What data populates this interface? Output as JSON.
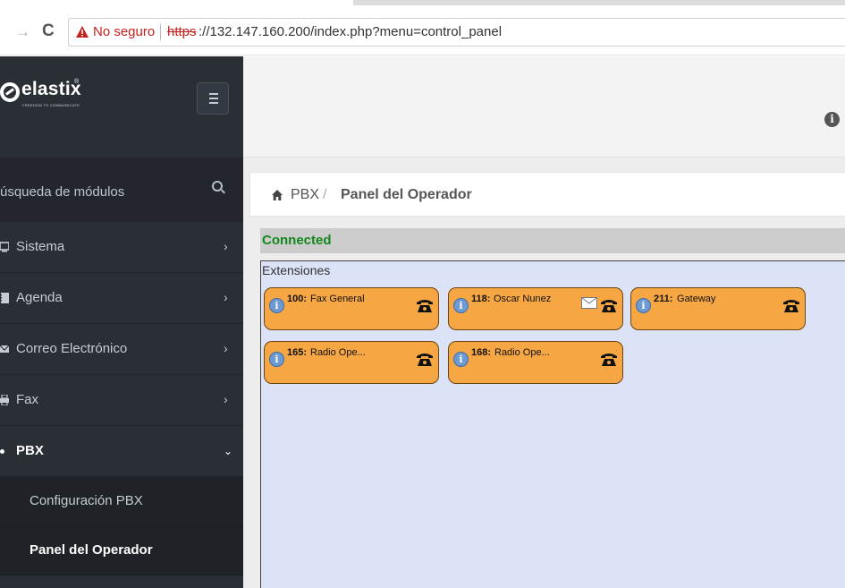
{
  "browser": {
    "insecure_label": "No seguro",
    "url_scheme": "https",
    "url_rest": "://132.147.160.200/index.php?menu=control_panel"
  },
  "sidebar": {
    "logo_text": "elastix",
    "logo_registered": "®",
    "logo_tagline": "FREEDOM TO COMMUNICATE",
    "search_placeholder": "úsqueda de módulos",
    "items": [
      {
        "label": "Sistema",
        "icon": "monitor-icon"
      },
      {
        "label": "Agenda",
        "icon": "address-book-icon"
      },
      {
        "label": "Correo Electrónico",
        "icon": "envelope-icon"
      },
      {
        "label": "Fax",
        "icon": "printer-icon"
      },
      {
        "label": "PBX",
        "icon": "bullet-icon"
      }
    ],
    "subitems": [
      {
        "label": "Configuración PBX"
      },
      {
        "label": "Panel del Operador"
      }
    ]
  },
  "header": {
    "info_icon": "info-icon",
    "info_glyph": "i"
  },
  "breadcrumb": {
    "section": "PBX",
    "separator": "/",
    "current": "Panel del Operador"
  },
  "status": {
    "text": "Connected",
    "color": "#13881a"
  },
  "panel": {
    "title": "Extensiones",
    "color": "#dde3f6",
    "card_color": "#f6a642",
    "extensions": [
      {
        "number": "100:",
        "name": "Fax General",
        "voicemail": false
      },
      {
        "number": "118:",
        "name": "Oscar Nunez",
        "voicemail": true
      },
      {
        "number": "211:",
        "name": "Gateway",
        "voicemail": false
      },
      {
        "number": "165:",
        "name": "Radio Ope...",
        "voicemail": false
      },
      {
        "number": "168:",
        "name": "Radio Ope...",
        "voicemail": false
      }
    ]
  }
}
